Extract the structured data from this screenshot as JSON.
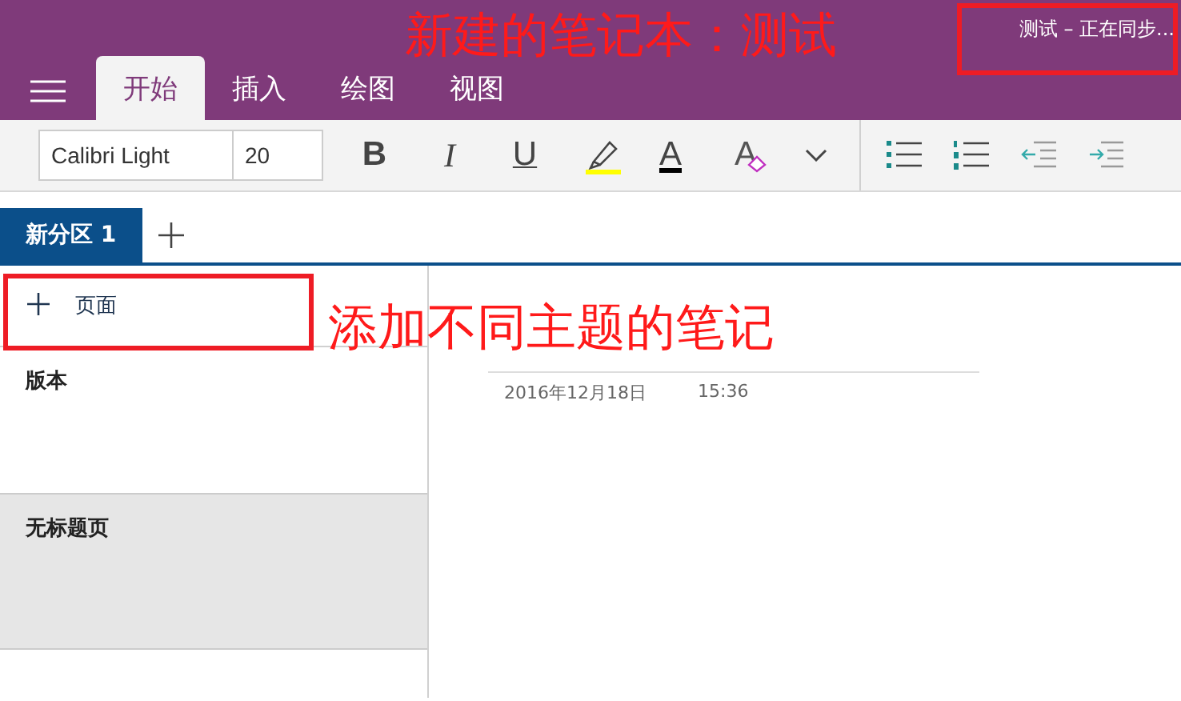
{
  "annotation_title": "新建的笔记本：测试",
  "sync_status": "测试 – 正在同步...",
  "ribbon_tabs": [
    {
      "label": "开始",
      "selected": true
    },
    {
      "label": "插入",
      "selected": false
    },
    {
      "label": "绘图",
      "selected": false
    },
    {
      "label": "视图",
      "selected": false
    }
  ],
  "font": {
    "name": "Calibri Light",
    "size": "20"
  },
  "format_tools": [
    {
      "kind": "bold",
      "label": "B"
    },
    {
      "kind": "italic",
      "label": "I"
    },
    {
      "kind": "underline",
      "label": "U"
    },
    {
      "kind": "highlight"
    },
    {
      "kind": "font-color",
      "label": "A"
    },
    {
      "kind": "clear",
      "label": "A"
    },
    {
      "kind": "more"
    }
  ],
  "paragraph_tools": [
    {
      "kind": "bullets"
    },
    {
      "kind": "numbering"
    },
    {
      "kind": "outdent"
    },
    {
      "kind": "indent"
    }
  ],
  "sections": [
    {
      "label": "新分区 1",
      "selected": true
    }
  ],
  "add_page": "页面",
  "annotation_note": "添加不同主题的笔记",
  "pages": [
    {
      "title": "版本",
      "selected": false
    },
    {
      "title": "无标题页",
      "selected": true
    }
  ],
  "note": {
    "date": "2016年12月18日",
    "time": "15:36"
  }
}
